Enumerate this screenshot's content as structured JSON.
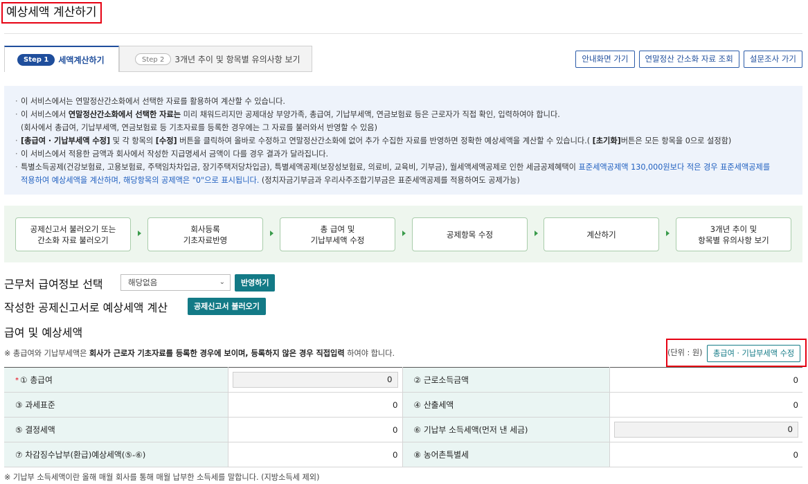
{
  "page_title": "예상세액 계산하기",
  "tabs": {
    "active": {
      "step": "Step 1",
      "label": "세액계산하기"
    },
    "inactive": {
      "step": "Step 2",
      "label": "3개년 추이 및 항목별 유의사항 보기"
    }
  },
  "top_buttons": [
    "안내화면 가기",
    "연말정산 간소화 자료 조회",
    "설문조사 가기"
  ],
  "info": {
    "l1": "이 서비스에서는 연말정산간소화에서 선택한 자료를 활용하여 계산할 수 있습니다.",
    "l2_a": "이 서비스에서 ",
    "l2_b": "연말정산간소화에서 선택한 자료는",
    "l2_c": " 미리 채워드리지만 공제대상 부양가족, 총급여, 기납부세액, 연금보험료 등은 근로자가 직접 확인, 입력하여야 합니다.",
    "l3": "(회사에서 총급여, 기납부세액, 연금보험료 등 기초자료를 등록한 경우에는 그 자료를 불러와서 반영할 수 있음)",
    "l4_a": "[총급여 · 기납부세액 수정]",
    "l4_b": " 및 각 항목의 ",
    "l4_c": "[수정]",
    "l4_d": " 버튼을 클릭하여 올바로 수정하고 연말정산간소화에 없어 추가 수집한 자료를 반영하면 정확한 예상세액을 계산할 수 있습니다.( ",
    "l4_e": "[초기화]",
    "l4_f": "버튼은 모든 항목을 0으로 설정함)",
    "l5": "이 서비스에서 적용한 금액과 회사에서 작성한 지급명세서 금액이 다를 경우 결과가 달라집니다.",
    "l6_a": "특별소득공제(건강보험료, 고용보험료, 주택임차차입금, 장기주택저당차입금), 특별세액공제(보장성보험료, 의료비, 교육비, 기부금), 월세액세액공제로 인한 세금공제혜택이 ",
    "l6_b": "표준세액공제액 130,000원보다 적은 경우 표준세액공제를",
    "l7_a": "적용하여 예상세액을 계산하며, 해당항목의 공제액은 \"0\"으로 표시됩니다.",
    "l7_b": " (정치자금기부금과 우리사주조합기부금은 표준세액공제를 적용하여도 공제가능)"
  },
  "flow_steps": [
    "공제신고서 불러오기 또는\n간소화 자료 불러오기",
    "회사등록\n기초자료반영",
    "총 급여 및\n기납부세액 수정",
    "공제항목 수정",
    "계산하기",
    "3개년 추이 및\n항목별 유의사항 보기"
  ],
  "workplace": {
    "heading": "근무처 급여정보 선택",
    "select_value": "해당없음",
    "apply_button": "반영하기"
  },
  "declaration": {
    "heading": "작성한 공제신고서로 예상세액 계산",
    "load_button": "공제신고서 불러오기"
  },
  "salary_section": {
    "heading": "급여 및 예상세액",
    "note_a": "※ 총급여와 기납부세액은 ",
    "note_b": "회사가 근로자 기초자료를 등록한 경우에 보이며, 등록하지 않은 경우 직접입력",
    "note_c": " 하여야 합니다.",
    "unit": "(단위 : 원)",
    "edit_button": "총급여 · 기납부세액 수정"
  },
  "result_table": [
    {
      "l1": "① 총급여",
      "v1": "0",
      "l2": "② 근로소득금액",
      "v2": "0"
    },
    {
      "l1": "③ 과세표준",
      "v1": "0",
      "l2": "④ 산출세액",
      "v2": "0"
    },
    {
      "l1": "⑤ 결정세액",
      "v1": "0",
      "l2": "⑥ 기납부 소득세액(먼저 낸 세금)",
      "v2": "0"
    },
    {
      "l1": "⑦ 차감징수납부(환급)예상세액(⑤-⑥)",
      "v1": "0",
      "l2": "⑧ 농어촌특별세",
      "v2": "0"
    }
  ],
  "required_mark": "*",
  "footnote": "※ 기납부 소득세액이란 올해 매월 회사를 통해 매월 납부한 소득세를 말합니다. (지방소득세 제외)",
  "colors": {
    "accent_blue": "#1f4e9c",
    "teal": "#137a86",
    "highlight_red": "#e60012"
  }
}
